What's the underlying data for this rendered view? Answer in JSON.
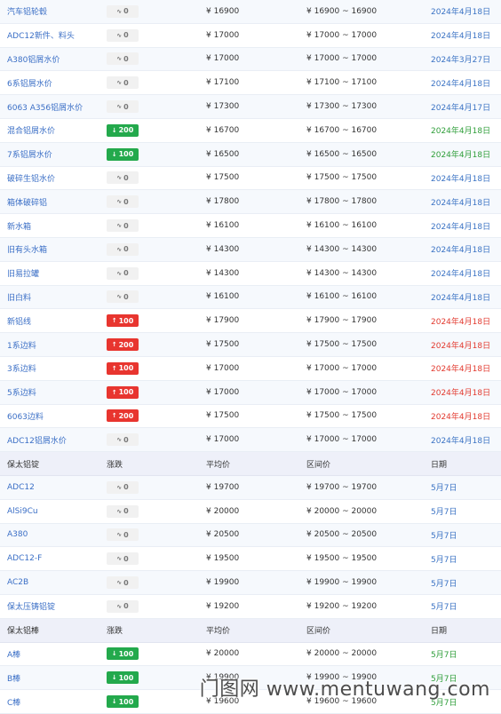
{
  "rows": [
    {
      "kind": "data",
      "name": "汽车铝轮毂",
      "change": "0",
      "dir": "flat",
      "avg": "¥ 16900",
      "range": "¥ 16900 ~ 16900",
      "date": "2024年4月18日",
      "date_color": "blue"
    },
    {
      "kind": "data",
      "name": "ADC12新件、料头",
      "change": "0",
      "dir": "flat",
      "avg": "¥ 17000",
      "range": "¥ 17000 ~ 17000",
      "date": "2024年4月18日",
      "date_color": "blue"
    },
    {
      "kind": "data",
      "name": "A380铝屑水价",
      "change": "0",
      "dir": "flat",
      "avg": "¥ 17000",
      "range": "¥ 17000 ~ 17000",
      "date": "2024年3月27日",
      "date_color": "blue"
    },
    {
      "kind": "data",
      "name": "6系铝屑水价",
      "change": "0",
      "dir": "flat",
      "avg": "¥ 17100",
      "range": "¥ 17100 ~ 17100",
      "date": "2024年4月18日",
      "date_color": "blue"
    },
    {
      "kind": "data",
      "name": "6063 A356铝屑水价",
      "change": "0",
      "dir": "flat",
      "avg": "¥ 17300",
      "range": "¥ 17300 ~ 17300",
      "date": "2024年4月17日",
      "date_color": "blue"
    },
    {
      "kind": "data",
      "name": "混合铝屑水价",
      "change": "200",
      "dir": "down",
      "avg": "¥ 16700",
      "range": "¥ 16700 ~ 16700",
      "date": "2024年4月18日",
      "date_color": "green"
    },
    {
      "kind": "data",
      "name": "7系铝屑水价",
      "change": "100",
      "dir": "down",
      "avg": "¥ 16500",
      "range": "¥ 16500 ~ 16500",
      "date": "2024年4月18日",
      "date_color": "green"
    },
    {
      "kind": "data",
      "name": "破碎生铝水价",
      "change": "0",
      "dir": "flat",
      "avg": "¥ 17500",
      "range": "¥ 17500 ~ 17500",
      "date": "2024年4月18日",
      "date_color": "blue"
    },
    {
      "kind": "data",
      "name": "箱体破碎铝",
      "change": "0",
      "dir": "flat",
      "avg": "¥ 17800",
      "range": "¥ 17800 ~ 17800",
      "date": "2024年4月18日",
      "date_color": "blue"
    },
    {
      "kind": "data",
      "name": "新水箱",
      "change": "0",
      "dir": "flat",
      "avg": "¥ 16100",
      "range": "¥ 16100 ~ 16100",
      "date": "2024年4月18日",
      "date_color": "blue"
    },
    {
      "kind": "data",
      "name": "旧有头水箱",
      "change": "0",
      "dir": "flat",
      "avg": "¥ 14300",
      "range": "¥ 14300 ~ 14300",
      "date": "2024年4月18日",
      "date_color": "blue"
    },
    {
      "kind": "data",
      "name": "旧易拉罐",
      "change": "0",
      "dir": "flat",
      "avg": "¥ 14300",
      "range": "¥ 14300 ~ 14300",
      "date": "2024年4月18日",
      "date_color": "blue"
    },
    {
      "kind": "data",
      "name": "旧白料",
      "change": "0",
      "dir": "flat",
      "avg": "¥ 16100",
      "range": "¥ 16100 ~ 16100",
      "date": "2024年4月18日",
      "date_color": "blue"
    },
    {
      "kind": "data",
      "name": "新铝线",
      "change": "100",
      "dir": "up",
      "avg": "¥ 17900",
      "range": "¥ 17900 ~ 17900",
      "date": "2024年4月18日",
      "date_color": "red"
    },
    {
      "kind": "data",
      "name": "1系边料",
      "change": "200",
      "dir": "up",
      "avg": "¥ 17500",
      "range": "¥ 17500 ~ 17500",
      "date": "2024年4月18日",
      "date_color": "red"
    },
    {
      "kind": "data",
      "name": "3系边料",
      "change": "100",
      "dir": "up",
      "avg": "¥ 17000",
      "range": "¥ 17000 ~ 17000",
      "date": "2024年4月18日",
      "date_color": "red"
    },
    {
      "kind": "data",
      "name": "5系边料",
      "change": "100",
      "dir": "up",
      "avg": "¥ 17000",
      "range": "¥ 17000 ~ 17000",
      "date": "2024年4月18日",
      "date_color": "red"
    },
    {
      "kind": "data",
      "name": "6063边料",
      "change": "200",
      "dir": "up",
      "avg": "¥ 17500",
      "range": "¥ 17500 ~ 17500",
      "date": "2024年4月18日",
      "date_color": "red"
    },
    {
      "kind": "data",
      "name": "ADC12铝屑水价",
      "change": "0",
      "dir": "flat",
      "avg": "¥ 17000",
      "range": "¥ 17000 ~ 17000",
      "date": "2024年4月18日",
      "date_color": "blue"
    },
    {
      "kind": "header",
      "name": "保太铝锭",
      "change": "涨跌",
      "avg": "平均价",
      "range": "区间价",
      "date": "日期"
    },
    {
      "kind": "data",
      "name": "ADC12",
      "change": "0",
      "dir": "flat",
      "avg": "¥ 19700",
      "range": "¥ 19700 ~ 19700",
      "date": "5月7日",
      "date_color": "blue"
    },
    {
      "kind": "data",
      "name": "AlSi9Cu",
      "change": "0",
      "dir": "flat",
      "avg": "¥ 20000",
      "range": "¥ 20000 ~ 20000",
      "date": "5月7日",
      "date_color": "blue"
    },
    {
      "kind": "data",
      "name": "A380",
      "change": "0",
      "dir": "flat",
      "avg": "¥ 20500",
      "range": "¥ 20500 ~ 20500",
      "date": "5月7日",
      "date_color": "blue"
    },
    {
      "kind": "data",
      "name": "ADC12-F",
      "change": "0",
      "dir": "flat",
      "avg": "¥ 19500",
      "range": "¥ 19500 ~ 19500",
      "date": "5月7日",
      "date_color": "blue"
    },
    {
      "kind": "data",
      "name": "AC2B",
      "change": "0",
      "dir": "flat",
      "avg": "¥ 19900",
      "range": "¥ 19900 ~ 19900",
      "date": "5月7日",
      "date_color": "blue"
    },
    {
      "kind": "data",
      "name": "保太压铸铝锭",
      "change": "0",
      "dir": "flat",
      "avg": "¥ 19200",
      "range": "¥ 19200 ~ 19200",
      "date": "5月7日",
      "date_color": "blue"
    },
    {
      "kind": "header",
      "name": "保太铝棒",
      "change": "涨跌",
      "avg": "平均价",
      "range": "区间价",
      "date": "日期"
    },
    {
      "kind": "data",
      "name": "A棒",
      "change": "100",
      "dir": "down",
      "avg": "¥ 20000",
      "range": "¥ 20000 ~ 20000",
      "date": "5月7日",
      "date_color": "green"
    },
    {
      "kind": "data",
      "name": "B棒",
      "change": "100",
      "dir": "down",
      "avg": "¥ 19900",
      "range": "¥ 19900 ~ 19900",
      "date": "5月7日",
      "date_color": "green"
    },
    {
      "kind": "data",
      "name": "C棒",
      "change": "100",
      "dir": "down",
      "avg": "¥ 19600",
      "range": "¥ 19600 ~ 19600",
      "date": "5月7日",
      "date_color": "green"
    }
  ],
  "glyphs": {
    "flat": "∿",
    "down": "↓",
    "up": "↑"
  },
  "watermark": "门图网 www.mentuwang.com",
  "colors": {
    "down": "#23a94c",
    "up": "#e8352f",
    "link": "#3b6fc6"
  }
}
